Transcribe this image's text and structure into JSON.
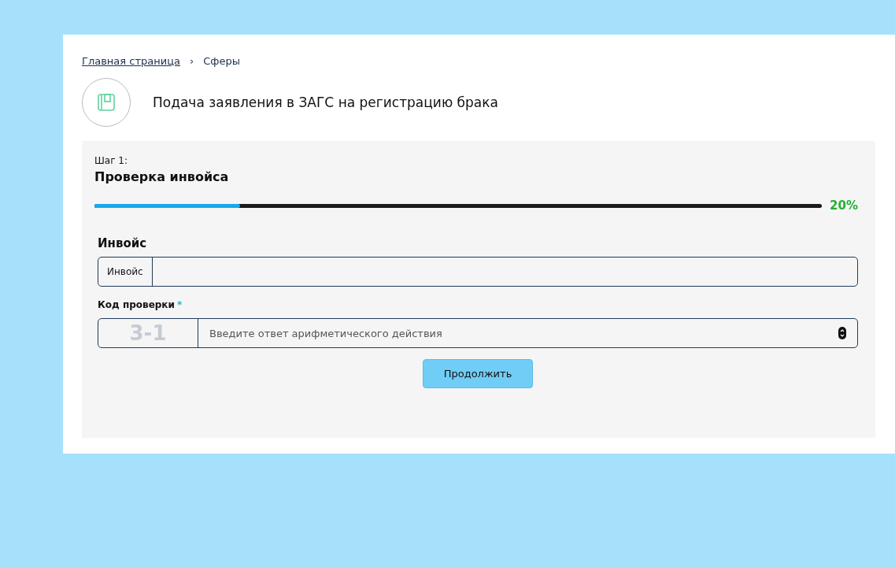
{
  "breadcrumbs": [
    {
      "label": "Главная страница",
      "link": true
    },
    {
      "label": "›",
      "link": false
    },
    {
      "label": "Сферы",
      "link": false
    }
  ],
  "service": {
    "title": "Подача заявления в ЗАГС на регистрацию брака"
  },
  "step": {
    "label": "Шаг 1:",
    "title": "Проверка инвойса"
  },
  "progress": {
    "level": 0.2,
    "reading": "20%"
  },
  "form": {
    "section_title": "Инвойс",
    "invoice_field": {
      "addon": "Инвойс"
    },
    "captcha_field": {
      "label": "Код проверки",
      "required": true,
      "required_mark": "*",
      "captcha": "3-1",
      "placeholder": "Введите ответ арифметического действия"
    },
    "submit": "Продолжить"
  }
}
